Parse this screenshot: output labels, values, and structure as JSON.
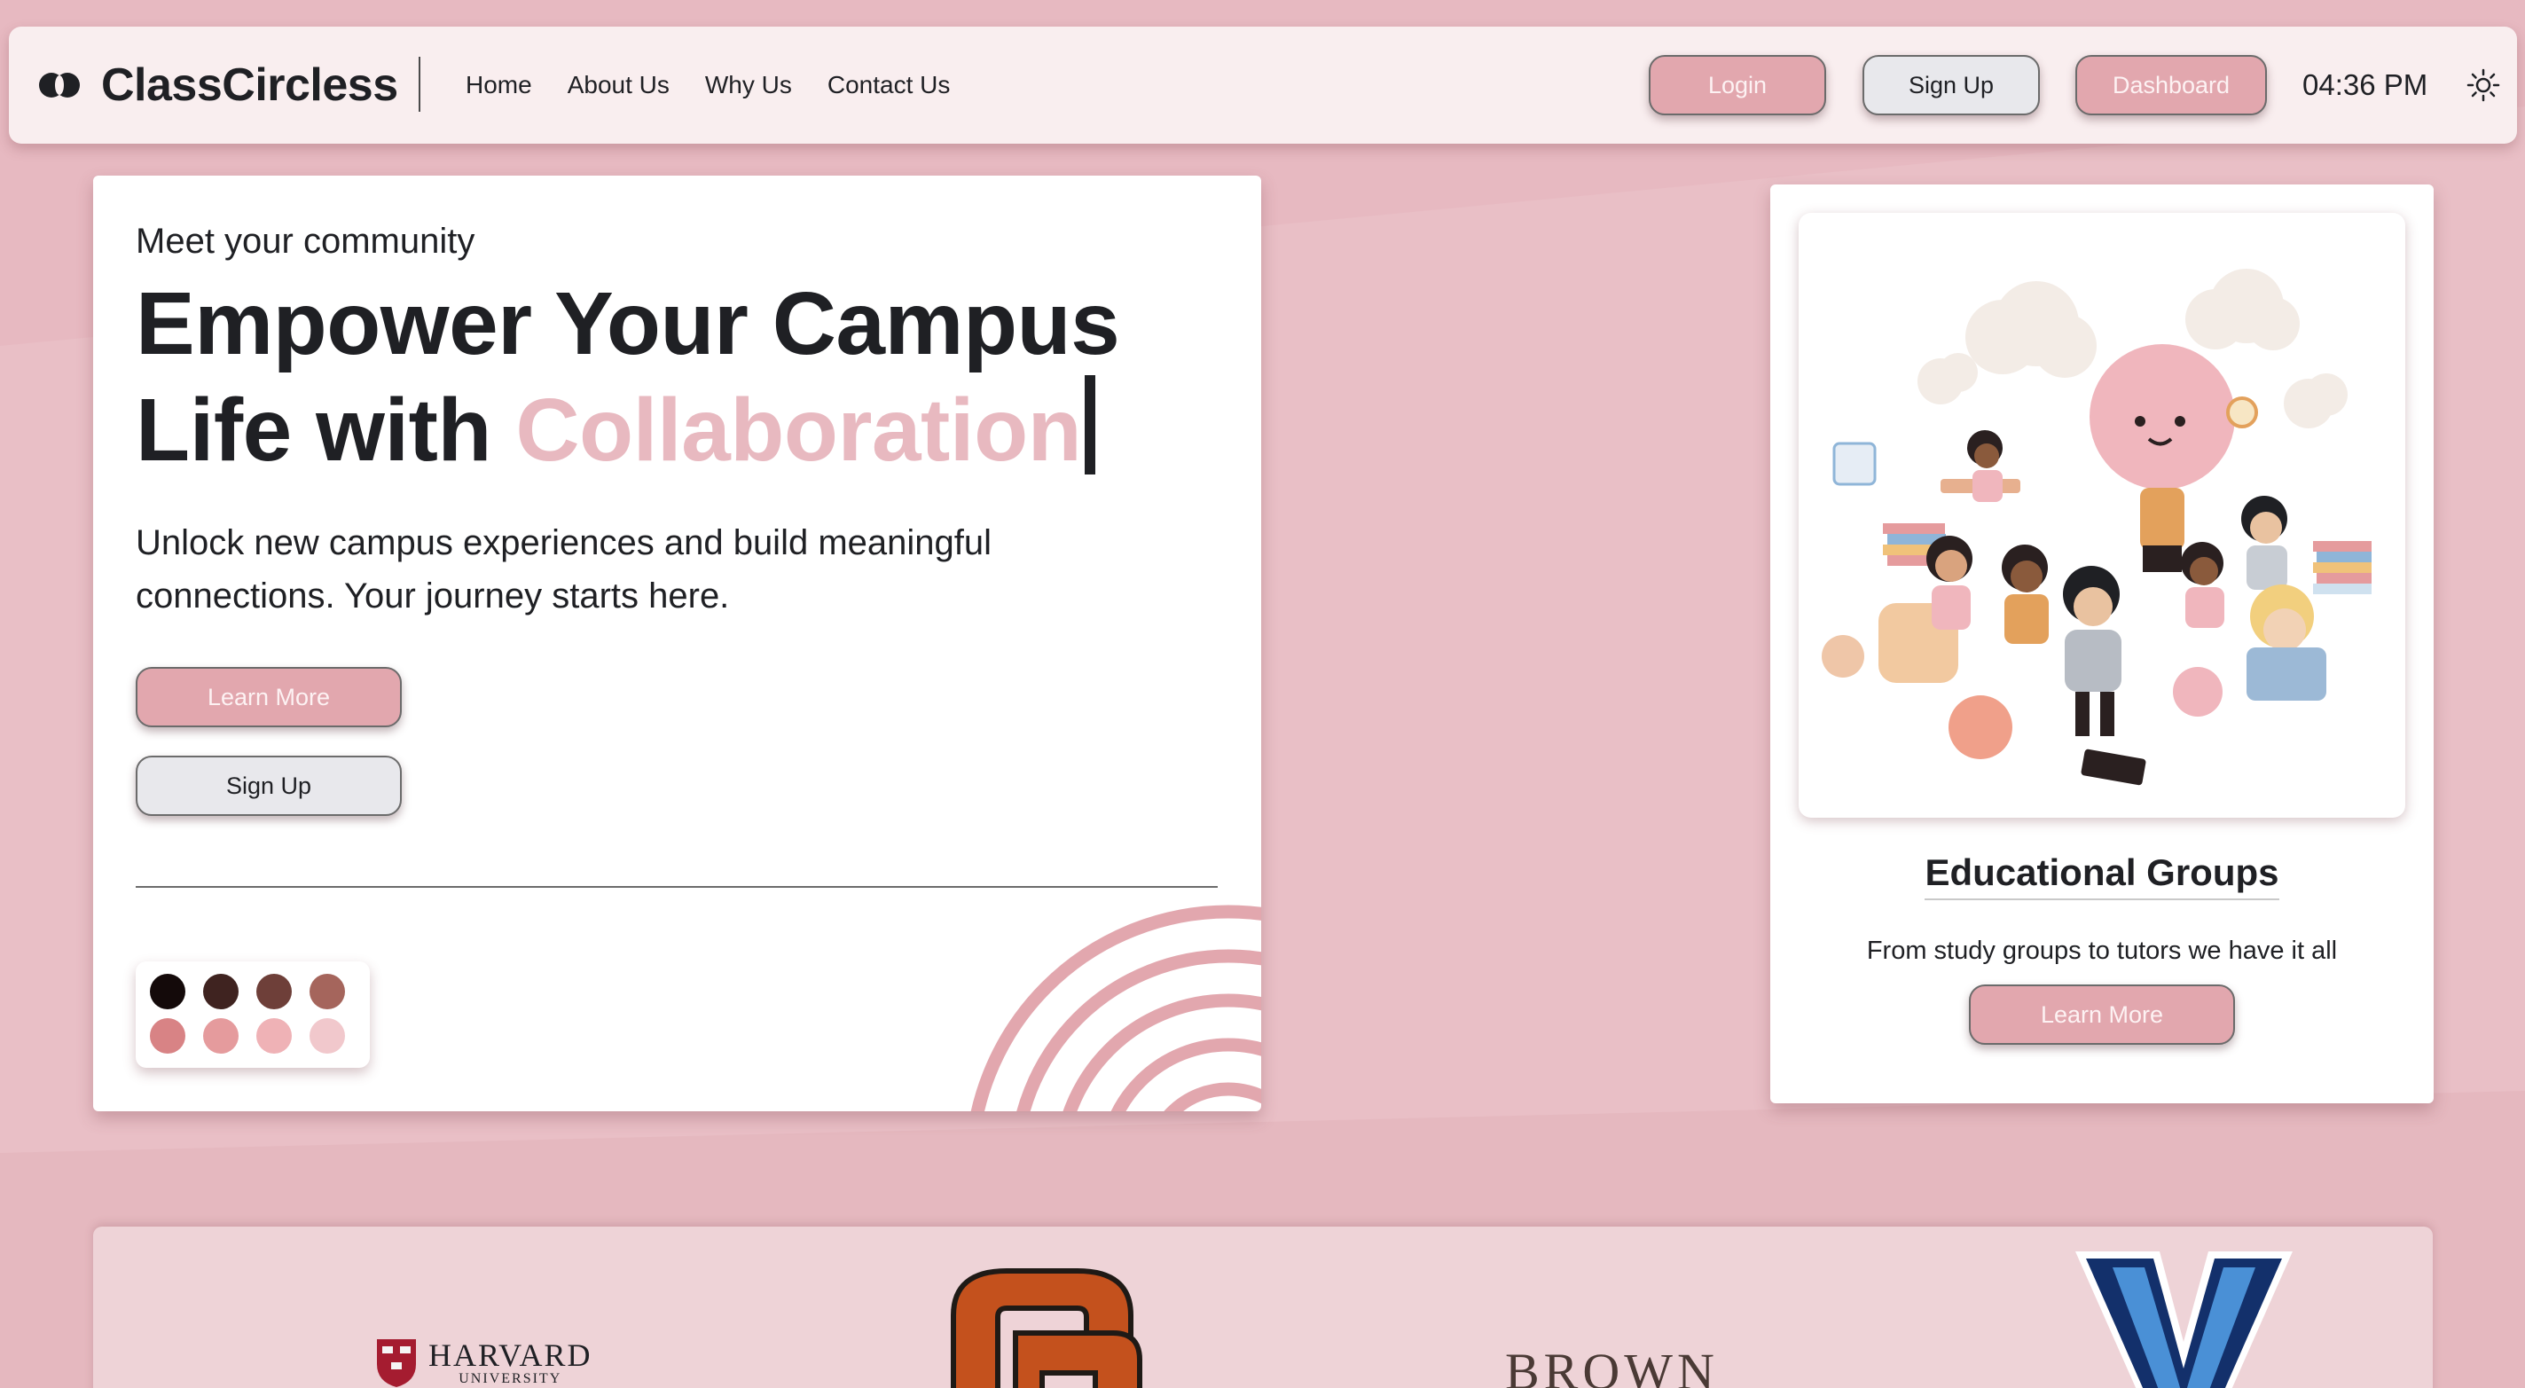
{
  "navbar": {
    "brand": "ClassCircless",
    "links": [
      "Home",
      "About Us",
      "Why Us",
      "Contact Us"
    ],
    "login_label": "Login",
    "signup_label": "Sign Up",
    "dashboard_label": "Dashboard",
    "time": "04:36 PM",
    "theme_icon": "sun-icon"
  },
  "hero": {
    "eyebrow": "Meet your community",
    "title_line1": "Empower Your Campus",
    "title_line2_prefix": "Life with ",
    "title_accent": "Collaboration",
    "description": "Unlock new campus experiences and build meaningful connections. Your journey starts here.",
    "learn_more_label": "Learn More",
    "signup_label": "Sign Up",
    "palette": [
      "#140a0a",
      "#3f2320",
      "#6e3f39",
      "#a5655c",
      "#d88385",
      "#e59b9d",
      "#efb2b6",
      "#f1c8cc"
    ]
  },
  "groups": {
    "title": "Educational Groups",
    "description": "From study groups to tutors we have it all",
    "learn_more_label": "Learn More"
  },
  "logos": {
    "harvard_name": "HARVARD",
    "harvard_sub": "UNIVERSITY",
    "brown": "BROWN"
  },
  "colors": {
    "background": "#e9bfc6",
    "accent": "#e2a7ae",
    "accent_text": "#e8b9c0",
    "osu_orange": "#c4511d",
    "villanova_blue": "#13306b"
  }
}
